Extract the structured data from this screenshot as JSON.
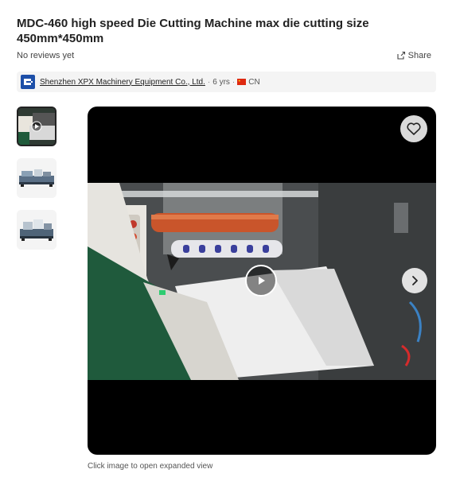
{
  "product": {
    "title": "MDC-460 high speed Die Cutting Machine max die cutting size 450mm*450mm",
    "reviews": "No reviews yet",
    "share_label": "Share"
  },
  "supplier": {
    "name": "Shenzhen XPX Machinery Equipment Co., Ltd.",
    "years": "6 yrs",
    "country": "CN",
    "separator": "·"
  },
  "gallery": {
    "caption": "Click image to open expanded view",
    "thumbnails": [
      "video-thumbnail",
      "machine-image-1",
      "machine-image-2"
    ]
  },
  "icons": {
    "share": "share-icon",
    "favorite": "heart-icon",
    "play": "play-icon",
    "next": "chevron-right-icon"
  }
}
